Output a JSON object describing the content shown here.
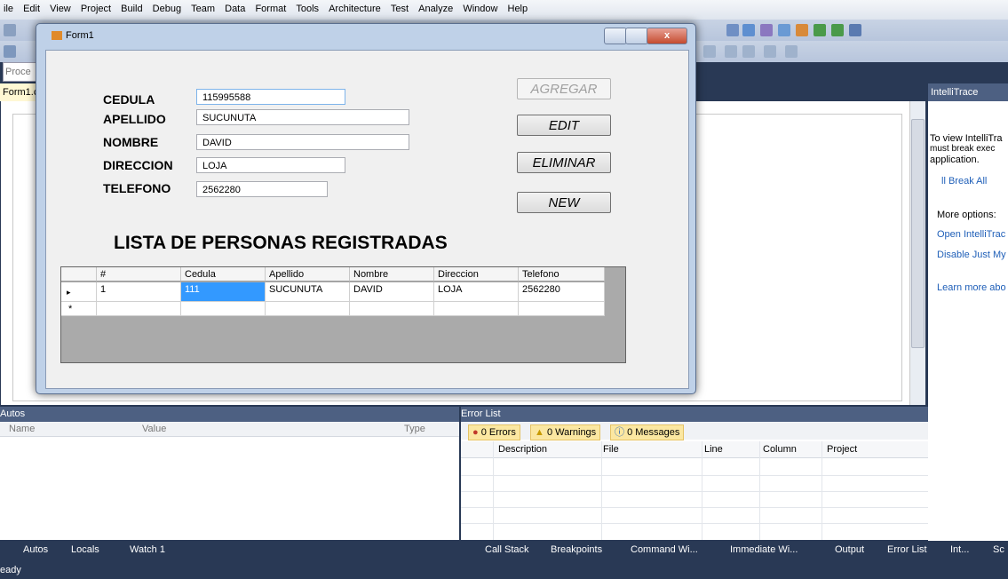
{
  "menu": [
    "ile",
    "Edit",
    "View",
    "Project",
    "Build",
    "Debug",
    "Team",
    "Data",
    "Format",
    "Tools",
    "Architecture",
    "Test",
    "Analyze",
    "Window",
    "Help"
  ],
  "toolbar": {
    "process_label": "Proce"
  },
  "document_tab": "Form1.c",
  "form": {
    "title": "Form1",
    "close_glyph": "x",
    "labels": {
      "cedula": "CEDULA",
      "apellido": "APELLIDO",
      "nombre": "NOMBRE",
      "direccion": "DIRECCION",
      "telefono": "TELEFONO"
    },
    "values": {
      "cedula": "115995588",
      "apellido": "SUCUNUTA",
      "nombre": "DAVID",
      "direccion": "LOJA",
      "telefono": "2562280"
    },
    "buttons": {
      "agregar": "AGREGAR",
      "edit": "EDIT",
      "eliminar": "ELIMINAR",
      "new": "NEW"
    },
    "list_title": "LISTA DE PERSONAS REGISTRADAS",
    "grid": {
      "columns": [
        "#",
        "Cedula",
        "Apellido",
        "Nombre",
        "Direccion",
        "Telefono"
      ],
      "rows": [
        {
          "num": "1",
          "cedula": "111",
          "apellido": "SUCUNUTA",
          "nombre": "DAVID",
          "direccion": "LOJA",
          "telefono": "2562280"
        }
      ],
      "current_row_marker": "▸",
      "new_row_marker": "*"
    }
  },
  "intellitrace": {
    "title": "IntelliTrace",
    "text1": "To view IntelliTra",
    "text2": "must break exec",
    "text3": "application.",
    "break_all": "Break All",
    "more_options": "More options:",
    "open_link": "Open IntelliTrac",
    "disable_link": "Disable Just My",
    "learn_link": "Learn more abo"
  },
  "autos": {
    "title": "Autos",
    "col_name": "Name",
    "col_value": "Value",
    "col_type": "Type"
  },
  "error_list": {
    "title": "Error List",
    "errors": "0 Errors",
    "warnings": "0 Warnings",
    "messages": "0 Messages",
    "col_description": "Description",
    "col_file": "File",
    "col_line": "Line",
    "col_column": "Column",
    "col_project": "Project"
  },
  "bottom_tabs": {
    "autos": "Autos",
    "locals": "Locals",
    "watch": "Watch 1",
    "call_stack": "Call Stack",
    "breakpoints": "Breakpoints",
    "command": "Command Wi...",
    "immediate": "Immediate Wi...",
    "output": "Output",
    "error_list": "Error List",
    "intellitrace": "Int...",
    "sc": "Sc"
  },
  "status": "eady",
  "colors": {
    "chrome": "#293955",
    "header": "#4d6082",
    "selected_cell": "#3399ff",
    "pill": "#fbe7a1"
  }
}
